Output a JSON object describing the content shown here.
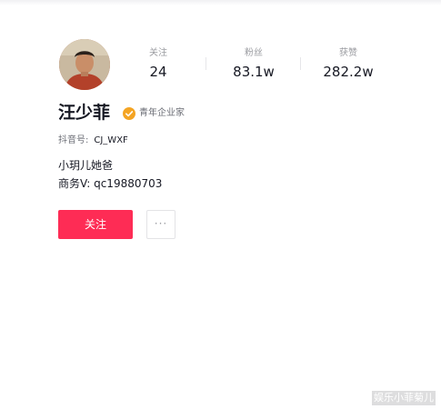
{
  "profile": {
    "name": "汪少菲",
    "verification": "青年企业家",
    "id_label": "抖音号:",
    "id_value": "CJ_WXF",
    "bio_line1": "小玥儿她爸",
    "bio_line2": "商务V:  qc19880703"
  },
  "stats": {
    "following_label": "关注",
    "following_value": "24",
    "fans_label": "粉丝",
    "fans_value": "83.1w",
    "likes_label": "获赞",
    "likes_value": "282.2w"
  },
  "actions": {
    "follow_label": "关注",
    "more_label": "···"
  },
  "watermark": "娱乐小菲菊儿",
  "colors": {
    "accent": "#fe2c55",
    "verify_badge": "#f4a423",
    "text_primary": "#161823",
    "text_secondary": "#9b9ca1"
  },
  "icons": {
    "verify": "verified-badge-icon",
    "avatar": "profile-avatar"
  }
}
